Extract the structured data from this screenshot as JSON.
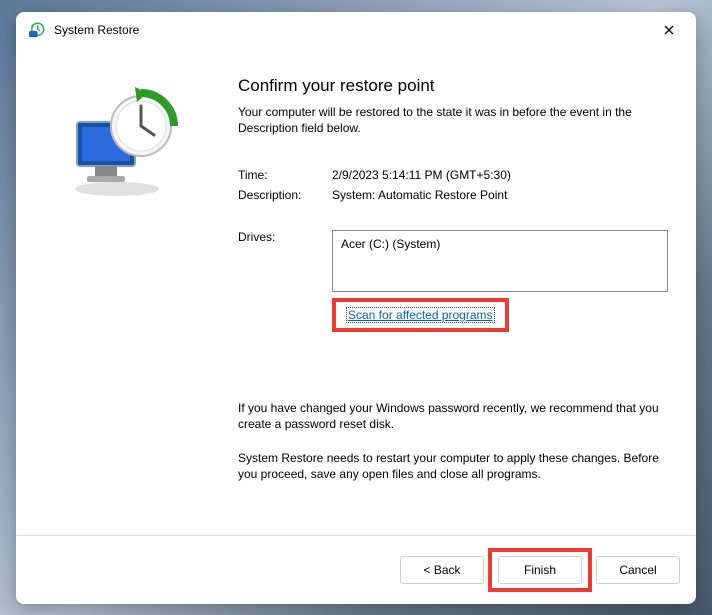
{
  "title": "System Restore",
  "heading": "Confirm your restore point",
  "intro": "Your computer will be restored to the state it was in before the event in the Description field below.",
  "time_label": "Time:",
  "time_value": "2/9/2023 5:14:11 PM (GMT+5:30)",
  "desc_label": "Description:",
  "desc_value": "System: Automatic Restore Point",
  "drives_label": "Drives:",
  "drives_value": "Acer (C:) (System)",
  "scan_link": "Scan for affected programs",
  "note1": "If you have changed your Windows password recently, we recommend that you create a password reset disk.",
  "note2": "System Restore needs to restart your computer to apply these changes. Before you proceed, save any open files and close all programs.",
  "back_btn": "< Back",
  "finish_btn": "Finish",
  "cancel_btn": "Cancel"
}
